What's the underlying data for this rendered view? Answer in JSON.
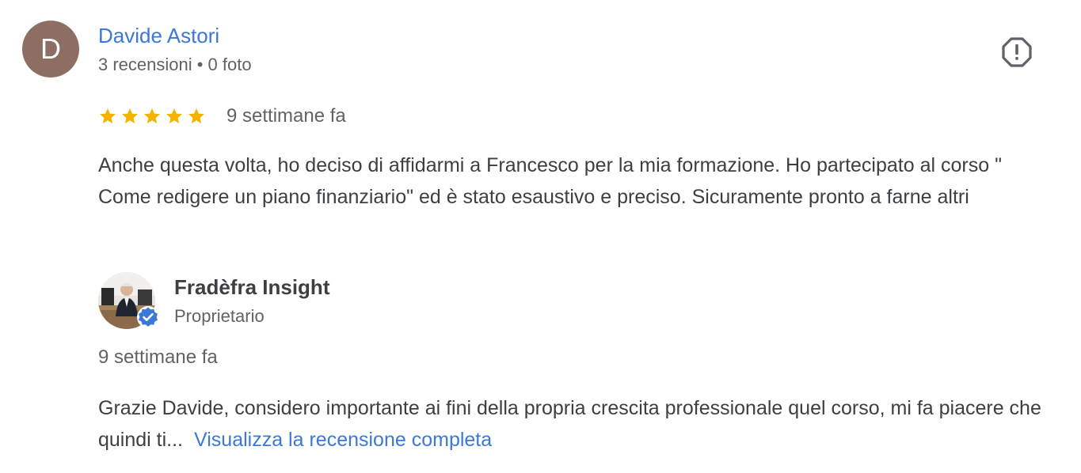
{
  "review": {
    "avatar_initial": "D",
    "avatar_color": "#8d6e63",
    "reviewer_name": "Davide Astori",
    "reviewer_meta": "3 recensioni • 0 foto",
    "report_icon": "report-flag-icon",
    "rating": 5,
    "rating_max": 5,
    "star_color": "#f4b400",
    "date": "9 settimane fa",
    "text": "Anche questa volta, ho deciso di affidarmi a Francesco per la mia formazione. Ho partecipato al corso \" Come redigere un piano finanziario\" ed è stato esaustivo e preciso. Sicuramente pronto a farne altri"
  },
  "owner_reply": {
    "owner_name": "Fradèfra Insight",
    "owner_role": "Proprietario",
    "verified_icon": "verified-check-icon",
    "verified_color": "#3b78d8",
    "date": "9 settimane fa",
    "text": "Grazie Davide, considero importante ai fini della propria crescita professionale quel corso, mi fa piacere che quindi ti...",
    "read_more_label": "Visualizza la recensione completa",
    "link_color": "#3b78d8"
  }
}
